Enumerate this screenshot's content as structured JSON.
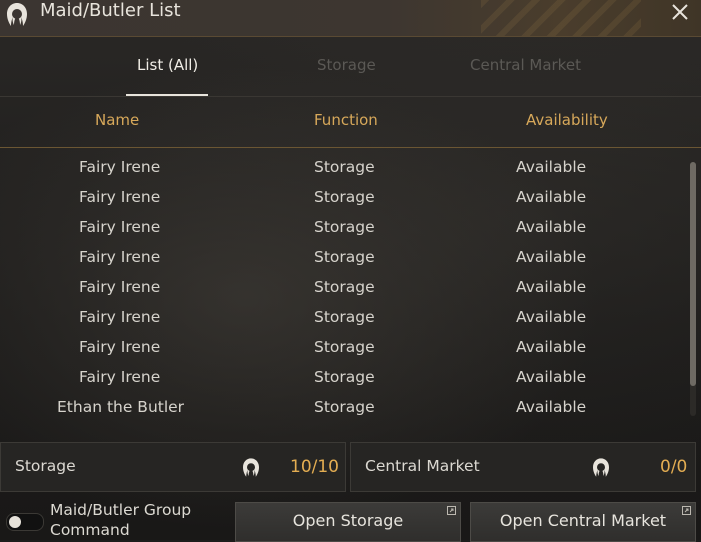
{
  "window": {
    "title": "Maid/Butler List"
  },
  "tabs": [
    {
      "label": "List (All)",
      "active": true
    },
    {
      "label": "Storage",
      "active": false
    },
    {
      "label": "Central Market",
      "active": false
    }
  ],
  "columns": {
    "name": "Name",
    "function": "Function",
    "availability": "Availability"
  },
  "rows": [
    {
      "name": "Fairy Irene",
      "function": "Storage",
      "availability": "Available"
    },
    {
      "name": "Fairy Irene",
      "function": "Storage",
      "availability": "Available"
    },
    {
      "name": "Fairy Irene",
      "function": "Storage",
      "availability": "Available"
    },
    {
      "name": "Fairy Irene",
      "function": "Storage",
      "availability": "Available"
    },
    {
      "name": "Fairy Irene",
      "function": "Storage",
      "availability": "Available"
    },
    {
      "name": "Fairy Irene",
      "function": "Storage",
      "availability": "Available"
    },
    {
      "name": "Fairy Irene",
      "function": "Storage",
      "availability": "Available"
    },
    {
      "name": "Fairy Irene",
      "function": "Storage",
      "availability": "Available"
    },
    {
      "name": "Ethan the Butler",
      "function": "Storage",
      "availability": "Available"
    }
  ],
  "summary": {
    "storage": {
      "label": "Storage",
      "count": "10/10"
    },
    "market": {
      "label": "Central Market",
      "count": "0/0"
    }
  },
  "group_command": {
    "label": "Maid/Butler Group Command",
    "enabled": false
  },
  "buttons": {
    "open_storage": "Open Storage",
    "open_market": "Open Central Market"
  },
  "colors": {
    "accent": "#d7a85a",
    "count": "#e3ad52"
  },
  "icons": {
    "title": "maid-silhouette-icon",
    "close": "close-icon"
  }
}
